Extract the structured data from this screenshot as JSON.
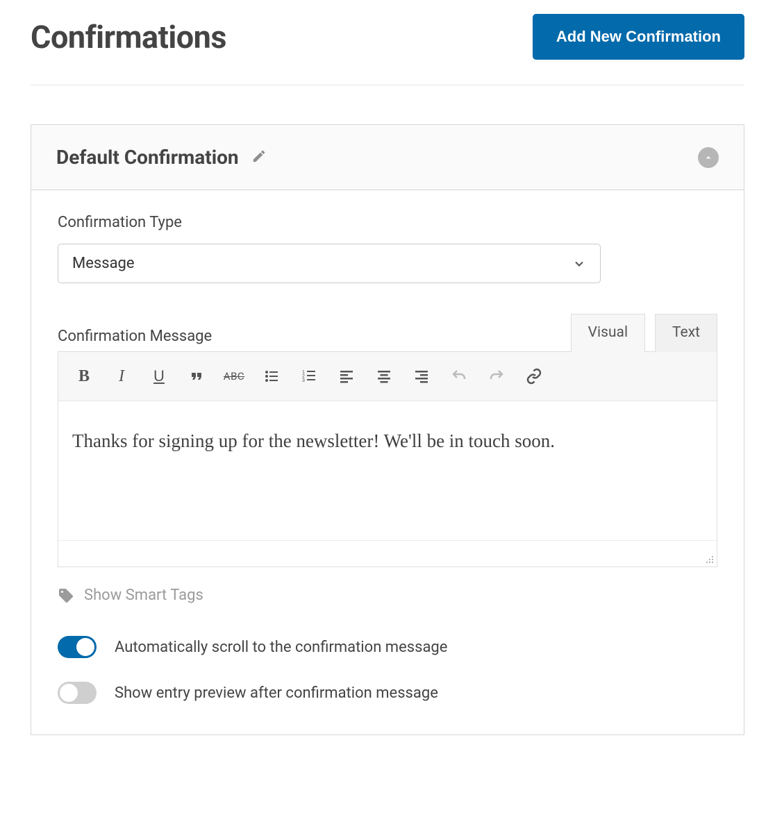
{
  "header": {
    "title": "Confirmations",
    "add_button": "Add New Confirmation"
  },
  "panel": {
    "title": "Default Confirmation"
  },
  "type_field": {
    "label": "Confirmation Type",
    "value": "Message"
  },
  "message_field": {
    "label": "Confirmation Message",
    "tabs": {
      "visual": "Visual",
      "text": "Text"
    },
    "content": "Thanks for signing up for the newsletter! We'll be in touch soon."
  },
  "toolbar": {
    "bold": "B",
    "italic": "I",
    "underline": "U",
    "strike": "ABC"
  },
  "smart_tags": {
    "label": "Show Smart Tags"
  },
  "toggles": {
    "autoscroll": {
      "label": "Automatically scroll to the confirmation message",
      "on": true
    },
    "entry_preview": {
      "label": "Show entry preview after confirmation message",
      "on": false
    }
  }
}
